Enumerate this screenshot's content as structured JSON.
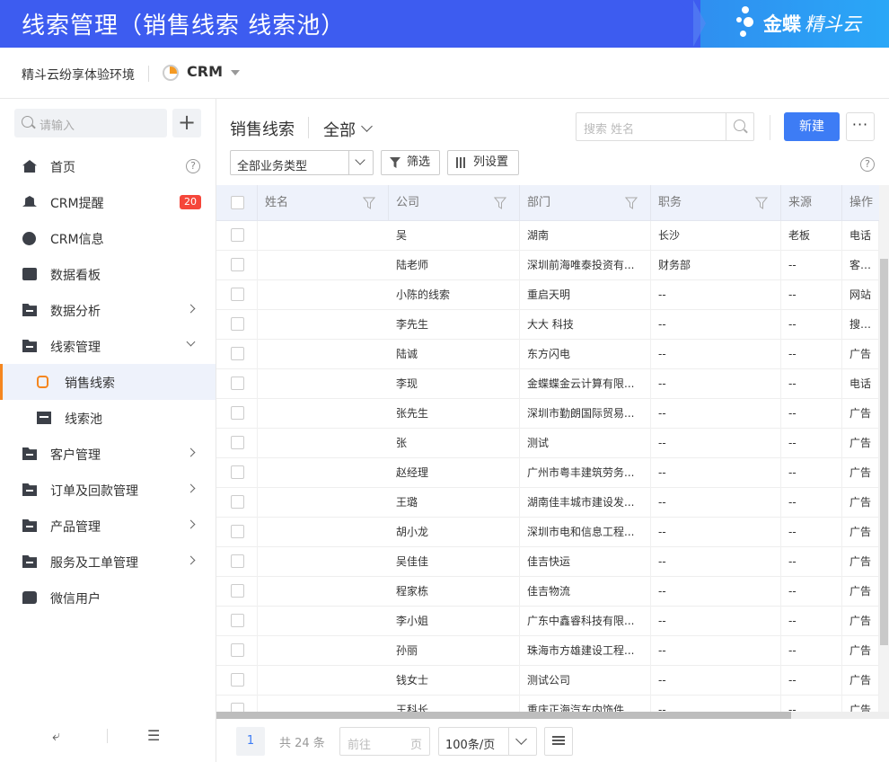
{
  "banner": {
    "title": "线索管理（销售线索 线索池）",
    "logo_brand": "金蝶",
    "logo_product": "精斗云"
  },
  "subbar": {
    "environment": "精斗云纷享体验环境",
    "app_name": "CRM"
  },
  "sidebar": {
    "search_placeholder": "请输入",
    "add_label": "+",
    "items": [
      {
        "label": "首页",
        "icon": "home-icon",
        "help": "?"
      },
      {
        "label": "CRM提醒",
        "icon": "bell-icon",
        "badge": "20"
      },
      {
        "label": "CRM信息",
        "icon": "pie-chart-icon"
      },
      {
        "label": "数据看板",
        "icon": "dashboard-icon"
      },
      {
        "label": "数据分析",
        "icon": "folder-icon"
      },
      {
        "label": "线索管理",
        "icon": "folder-icon"
      },
      {
        "label": "销售线索",
        "icon": "lead-flow-icon"
      },
      {
        "label": "线索池",
        "icon": "lead-pool-icon"
      },
      {
        "label": "客户管理",
        "icon": "folder-icon"
      },
      {
        "label": "订单及回款管理",
        "icon": "folder-icon"
      },
      {
        "label": "产品管理",
        "icon": "folder-icon"
      },
      {
        "label": "服务及工单管理",
        "icon": "folder-icon"
      },
      {
        "label": "微信用户",
        "icon": "wechat-user-icon"
      }
    ]
  },
  "main": {
    "title": "销售线索",
    "view": "全部",
    "search_placeholder": "搜索 姓名",
    "new_button": "新建",
    "more_button": "···",
    "business_type": "全部业务类型",
    "filter_button": "筛选",
    "columns_button": "列设置",
    "help": "?"
  },
  "table": {
    "headers": [
      "姓名",
      "公司",
      "部门",
      "职务",
      "来源",
      "操作"
    ],
    "rows": [
      [
        "吴",
        "湖南",
        "长沙",
        "老板",
        "电话"
      ],
      [
        "陆老师",
        "深圳前海唯泰投资有...",
        "财务部",
        "--",
        "客户介绍"
      ],
      [
        "小陈的线索",
        "重启天明",
        "--",
        "--",
        "网站"
      ],
      [
        "李先生",
        "大大 科技",
        "--",
        "--",
        "搜索引擎"
      ],
      [
        "陆诚",
        "东方闪电",
        "--",
        "--",
        "广告"
      ],
      [
        "李现",
        "金蝶蝶金云计算有限...",
        "--",
        "--",
        "电话"
      ],
      [
        "张先生",
        "深圳市勤朗国际贸易...",
        "--",
        "--",
        "广告"
      ],
      [
        "张",
        "测试",
        "--",
        "--",
        "广告"
      ],
      [
        "赵经理",
        "广州市粤丰建筑劳务...",
        "--",
        "--",
        "广告"
      ],
      [
        "王璐",
        "湖南佳丰城市建设发...",
        "--",
        "--",
        "广告"
      ],
      [
        "胡小龙",
        "深圳市电和信息工程...",
        "--",
        "--",
        "广告"
      ],
      [
        "吴佳佳",
        "佳吉快运",
        "--",
        "--",
        "广告"
      ],
      [
        "程家栋",
        "佳吉物流",
        "--",
        "--",
        "广告"
      ],
      [
        "李小姐",
        "广东中鑫睿科技有限...",
        "--",
        "--",
        "广告"
      ],
      [
        "孙丽",
        "珠海市方雄建设工程...",
        "--",
        "--",
        "广告"
      ],
      [
        "钱女士",
        "测试公司",
        "--",
        "--",
        "广告"
      ],
      [
        "王科长",
        "重庆正海汽车内饰件...",
        "--",
        "--",
        "广告"
      ]
    ]
  },
  "pager": {
    "current_page": "1",
    "total": "共 24 条",
    "goto_prefix": "前往",
    "goto_suffix": "页",
    "page_size": "100条/页"
  },
  "colors": {
    "banner": "#3d5cf0",
    "primary": "#3d7cf5",
    "active_accent": "#f5861f",
    "badge": "#f5463a"
  }
}
